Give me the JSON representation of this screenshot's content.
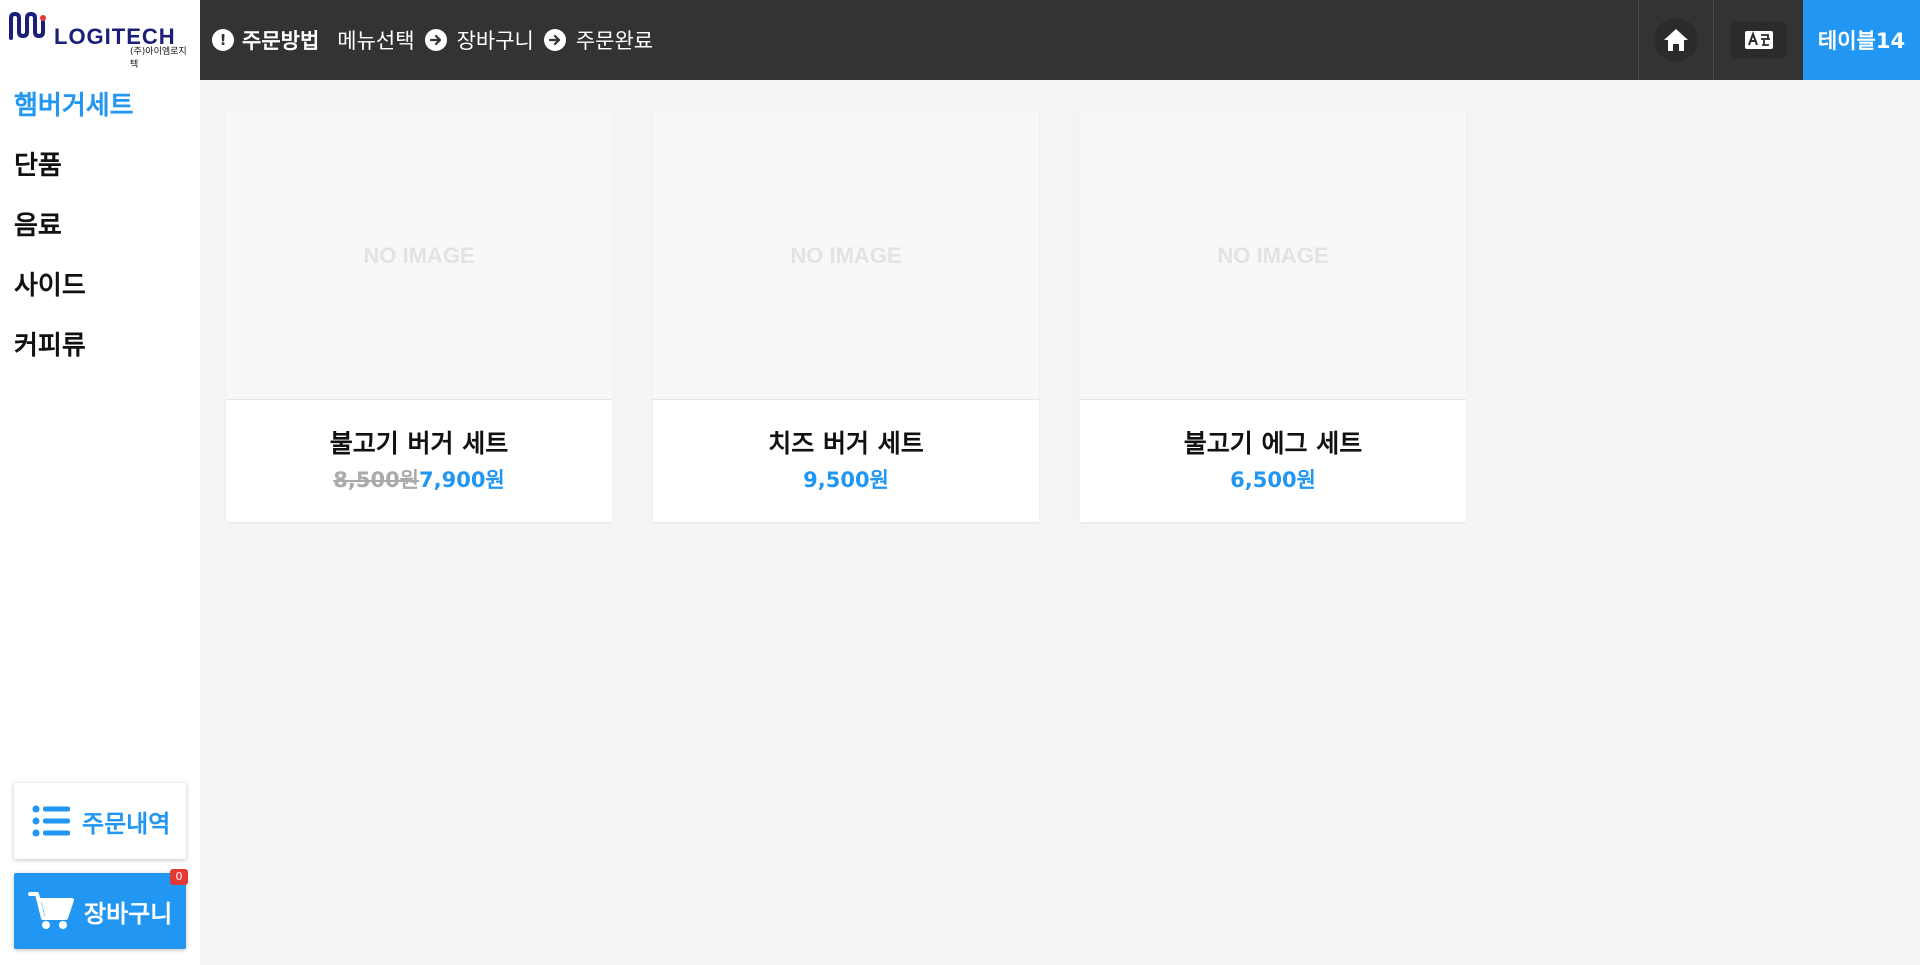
{
  "brand": {
    "name": "LOGITECH",
    "sub": "(주)아이엠로지텍"
  },
  "header": {
    "how_to_order": "주문방법",
    "steps": [
      "메뉴선택",
      "장바구니",
      "주문완료"
    ],
    "table": "테이블14"
  },
  "sidebar": {
    "categories": [
      {
        "label": "햄버거세트",
        "active": true
      },
      {
        "label": "단품",
        "active": false
      },
      {
        "label": "음료",
        "active": false
      },
      {
        "label": "사이드",
        "active": false
      },
      {
        "label": "커피류",
        "active": false
      }
    ],
    "order_history": "주문내역",
    "cart": "장바구니",
    "cart_count": "0"
  },
  "menu": {
    "no_image": "NO IMAGE",
    "items": [
      {
        "name": "불고기 버거 세트",
        "original_price": "8,500원",
        "price": "7,900원"
      },
      {
        "name": "치즈 버거 세트",
        "original_price": "",
        "price": "9,500원"
      },
      {
        "name": "불고기 에그 세트",
        "original_price": "",
        "price": "6,500원"
      }
    ]
  },
  "colors": {
    "accent": "#2196f3",
    "topbar": "#333333",
    "badge": "#e53935"
  }
}
